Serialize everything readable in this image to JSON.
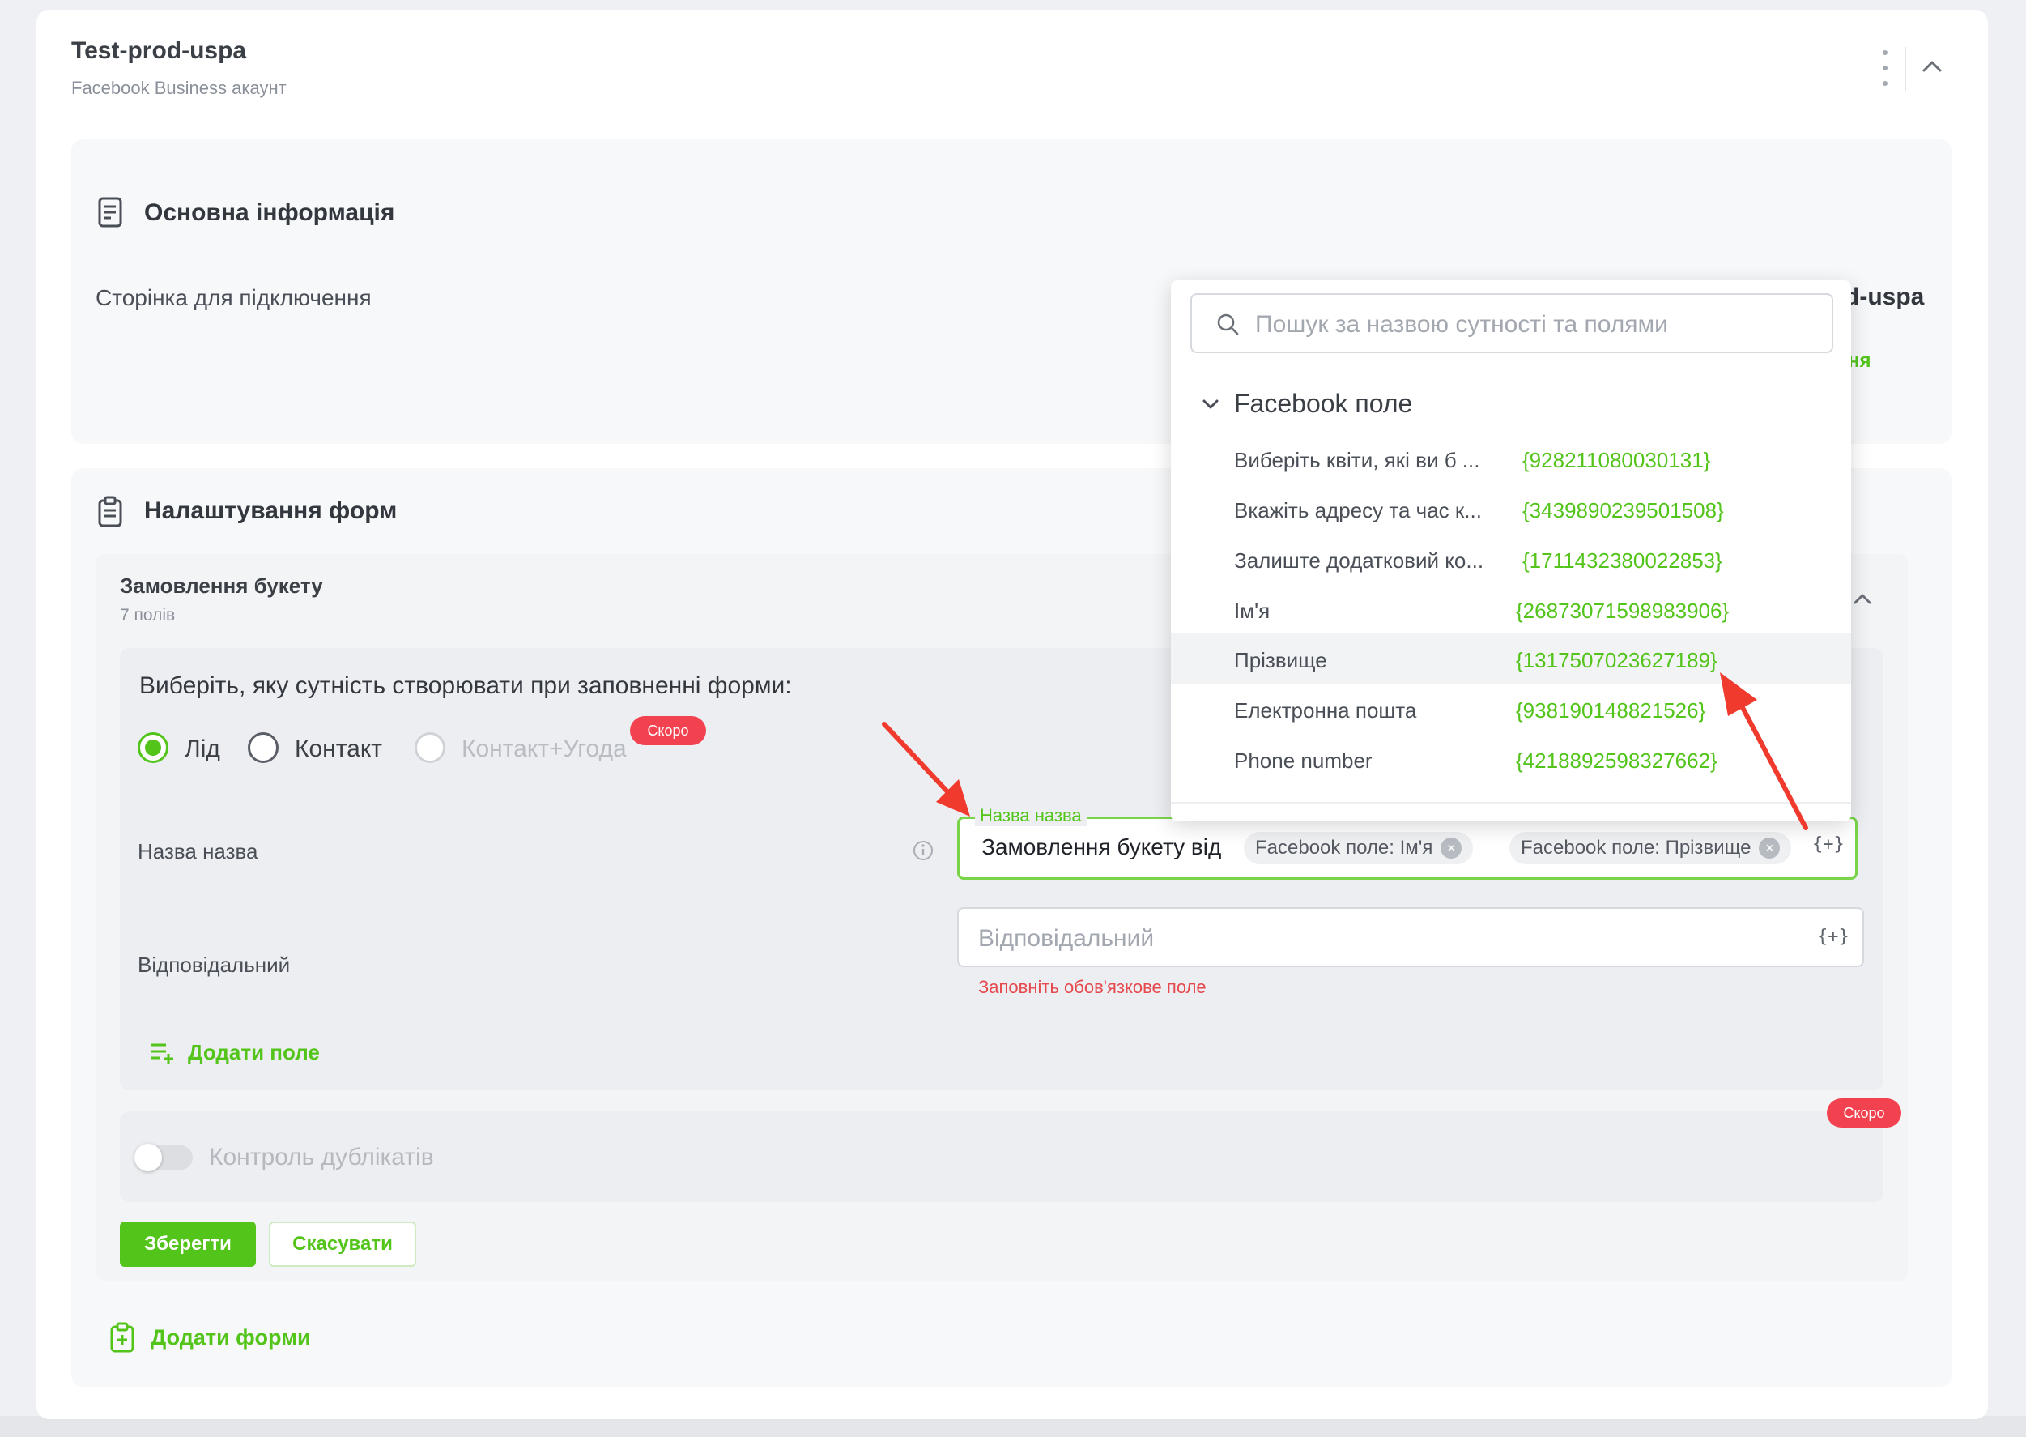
{
  "account": {
    "title": "Test-prod-uspa",
    "subtitle": "Facebook Business акаунт"
  },
  "basic_info": {
    "title": "Основна інформація",
    "page_label": "Сторінка для підключення",
    "page_value_partial": "d-uspa",
    "page_link_partial": "ня"
  },
  "forms": {
    "title": "Налаштування форм",
    "form_name": "Замовлення букету",
    "field_count": "7 полів",
    "entity_prompt": "Виберіть, яку сутність створювати при заповненні форми:",
    "options": [
      {
        "label": "Лід",
        "selected": true,
        "disabled": false
      },
      {
        "label": "Контакт",
        "selected": false,
        "disabled": false
      },
      {
        "label": "Контакт+Угода",
        "selected": false,
        "disabled": true
      }
    ],
    "soon_badge": "Скоро",
    "name_field": {
      "label": "Назва назва",
      "float_label": "Назва назва",
      "text": "Замовлення букету від",
      "chips": [
        "Facebook поле: Ім'я",
        "Facebook поле: Прізвище"
      ],
      "insert_icon": "{+}"
    },
    "responsible_field": {
      "label": "Відповідальний",
      "placeholder": "Відповідальний",
      "insert_icon": "{+}",
      "error": "Заповніть обов'язкове поле"
    },
    "add_field": "Додати поле",
    "duplicates": {
      "label": "Контроль дублікатів",
      "enabled": false,
      "badge": "Скоро"
    },
    "save": "Зберегти",
    "cancel": "Скасувати",
    "add_forms": "Додати форми"
  },
  "dropdown": {
    "search_placeholder": "Пошук за назвою сутності та полями",
    "group": "Facebook поле",
    "items": [
      {
        "name": "Виберіть квіти, які ви б ...",
        "value": "{928211080030131}"
      },
      {
        "name": "Вкажіть адресу та час к...",
        "value": "{3439890239501508}"
      },
      {
        "name": "Залиште додатковий ко...",
        "value": "{1711432380022853}"
      },
      {
        "name": "Ім'я",
        "value": "{26873071598983906}"
      },
      {
        "name": "Прізвище",
        "value": "{1317507023627189}",
        "highlighted": true
      },
      {
        "name": "Електронна пошта",
        "value": "{938190148821526}"
      },
      {
        "name": "Phone number",
        "value": "{4218892598327662}"
      }
    ]
  },
  "colors": {
    "accent": "#53c41a",
    "danger": "#f2414f",
    "error_text": "#e5484d"
  },
  "icons": [
    "kebab-icon",
    "chevron-up-icon",
    "document-icon",
    "clipboard-icon",
    "info-icon",
    "search-icon",
    "chevron-down-icon",
    "add-list-icon",
    "clipboard-plus-icon",
    "close-icon",
    "arrow-icon"
  ]
}
